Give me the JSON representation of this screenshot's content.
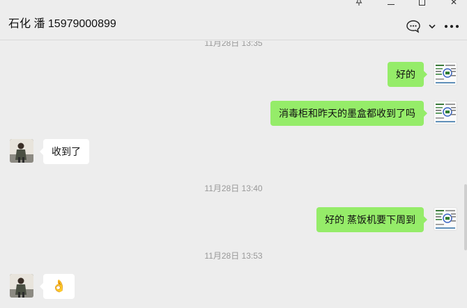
{
  "window": {
    "pin_icon": "pin-icon",
    "minimize_icon": "minimize-icon",
    "maximize_icon": "maximize-icon",
    "close_glyph": "✕"
  },
  "header": {
    "title": "石化 潘 15979000899",
    "icons": [
      "chat-bubble-icon",
      "chevron-down-icon",
      "more-icon"
    ]
  },
  "messages": [
    {
      "type": "time",
      "text": "11月28日 13:35"
    },
    {
      "type": "me",
      "text": "好的"
    },
    {
      "type": "me",
      "text": "消毒柜和昨天的墨盒都收到了吗"
    },
    {
      "type": "them",
      "text": "收到了"
    },
    {
      "type": "time",
      "text": "11月28日 13:40"
    },
    {
      "type": "me",
      "text": "好的 蒸饭机要下周到"
    },
    {
      "type": "time",
      "text": "11月28日 13:53"
    },
    {
      "type": "them",
      "text": "👌"
    }
  ],
  "colors": {
    "background": "#ededed",
    "my_bubble": "#95ec69",
    "their_bubble": "#ffffff",
    "timestamp": "#999999"
  }
}
